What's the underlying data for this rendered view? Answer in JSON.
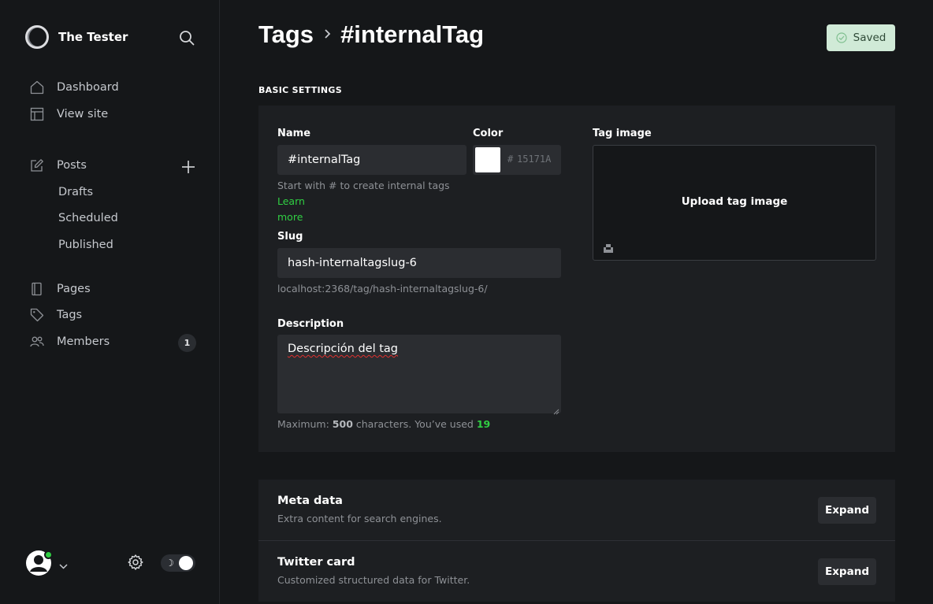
{
  "sidebar": {
    "brand": "The Tester",
    "nav": {
      "dashboard": "Dashboard",
      "view_site": "View site",
      "posts": "Posts",
      "drafts": "Drafts",
      "scheduled": "Scheduled",
      "published": "Published",
      "pages": "Pages",
      "tags": "Tags",
      "members": "Members",
      "members_count": "1"
    }
  },
  "header": {
    "breadcrumb_parent": "Tags",
    "breadcrumb_current": "#internalTag",
    "saved_label": "Saved"
  },
  "basic": {
    "section_title": "BASIC SETTINGS",
    "name_label": "Name",
    "name_value": "#internalTag",
    "color_label": "Color",
    "color_hash": "#",
    "color_value": "15171A",
    "name_hint": "Start with # to create internal tags",
    "learn": "Learn",
    "more": "more",
    "slug_label": "Slug",
    "slug_value": "hash-internaltagslug-6",
    "slug_url": "localhost:2368/tag/hash-internaltagslug-6/",
    "description_label": "Description",
    "description_value": "Descripción del tag",
    "max_prefix": "Maximum:",
    "max_chars": "500",
    "max_mid": "characters. You’ve used",
    "used_chars": "19",
    "image_label": "Tag image",
    "upload_label": "Upload tag image"
  },
  "meta": {
    "title": "Meta data",
    "subtitle": "Extra content for search engines.",
    "button": "Expand"
  },
  "twitter": {
    "title": "Twitter card",
    "subtitle": "Customized structured data for Twitter.",
    "button": "Expand"
  },
  "colors": {
    "accent_green": "#30cf43",
    "saved_bg": "#d0ead7",
    "background": "#151719",
    "card_bg": "#1d1f22"
  }
}
